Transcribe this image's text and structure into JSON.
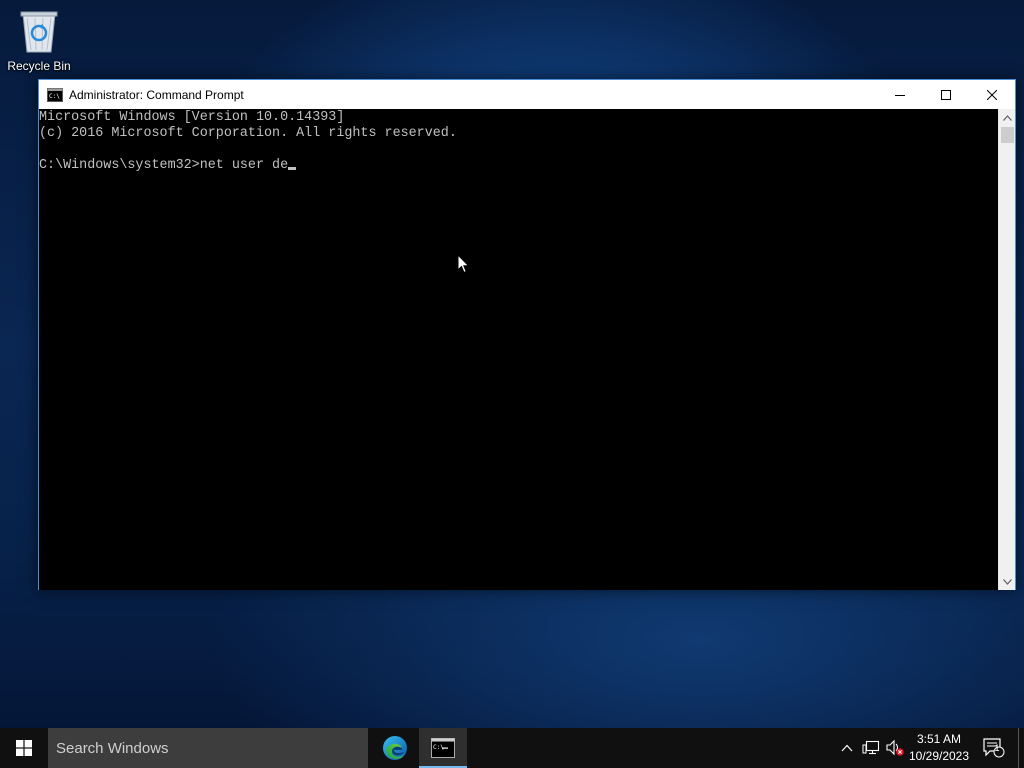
{
  "desktop": {
    "icons": [
      {
        "label": "Recycle Bin",
        "icon": "recycle-bin-icon"
      }
    ]
  },
  "window": {
    "title": "Administrator: Command Prompt",
    "icon": "cmd-icon",
    "controls": {
      "minimize": "minimize-icon",
      "maximize": "maximize-icon",
      "close": "close-icon"
    }
  },
  "console": {
    "lines": [
      "Microsoft Windows [Version 10.0.14393]",
      "(c) 2016 Microsoft Corporation. All rights reserved.",
      "",
      "C:\\Windows\\system32>net user de"
    ],
    "text_color": "#c0c0c0",
    "background": "#000000"
  },
  "taskbar": {
    "search_placeholder": "Search Windows",
    "apps": [
      {
        "name": "Microsoft Edge",
        "icon": "edge-icon",
        "active": false
      },
      {
        "name": "Command Prompt",
        "icon": "cmd-icon",
        "active": true
      }
    ],
    "tray": {
      "icons": [
        "chevron-up-icon",
        "network-icon",
        "volume-muted-icon",
        "notification-icon"
      ],
      "notification_count": "1"
    },
    "clock": {
      "time": "3:51 AM",
      "date": "10/29/2023"
    },
    "accent_color": "#76b9ed"
  }
}
